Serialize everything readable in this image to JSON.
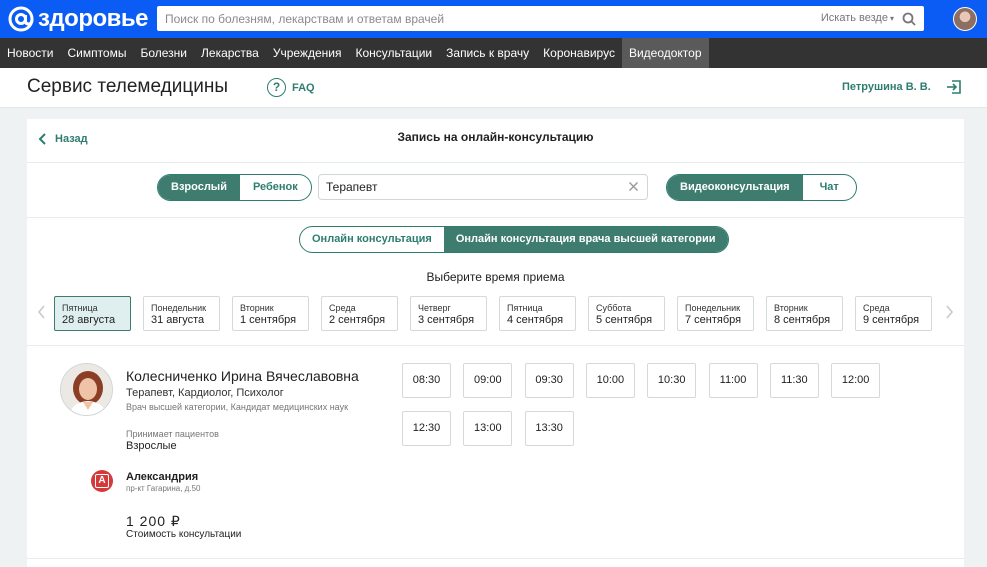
{
  "header": {
    "logo_text": "здоровье",
    "search_placeholder": "Поиск по болезням, лекарствам и ответам врачей",
    "search_scope": "Искать везде"
  },
  "nav": [
    {
      "label": "Новости",
      "active": false
    },
    {
      "label": "Симптомы",
      "active": false
    },
    {
      "label": "Болезни",
      "active": false
    },
    {
      "label": "Лекарства",
      "active": false
    },
    {
      "label": "Учреждения",
      "active": false
    },
    {
      "label": "Консультации",
      "active": false
    },
    {
      "label": "Запись к врачу",
      "active": false
    },
    {
      "label": "Коронавирус",
      "active": false
    },
    {
      "label": "Видеодоктор",
      "active": true
    }
  ],
  "page": {
    "title": "Сервис телемедицины",
    "faq": "FAQ",
    "user": "Петрушина В. В."
  },
  "booking": {
    "back": "Назад",
    "title": "Запись на онлайн-консультацию",
    "patient_types": [
      "Взрослый",
      "Ребенок"
    ],
    "specialty_value": "Терапевт",
    "consult_formats": [
      "Видеоконсультация",
      "Чат"
    ],
    "consult_types": [
      "Онлайн консультация",
      "Онлайн консультация врача высшей категории"
    ],
    "choose_time": "Выберите время приема",
    "days": [
      {
        "name": "Пятница",
        "date": "28 августа",
        "selected": true
      },
      {
        "name": "Понедельник",
        "date": "31 августа",
        "selected": false
      },
      {
        "name": "Вторник",
        "date": "1 сентября",
        "selected": false
      },
      {
        "name": "Среда",
        "date": "2 сентября",
        "selected": false
      },
      {
        "name": "Четверг",
        "date": "3 сентября",
        "selected": false
      },
      {
        "name": "Пятница",
        "date": "4 сентября",
        "selected": false
      },
      {
        "name": "Суббота",
        "date": "5 сентября",
        "selected": false
      },
      {
        "name": "Понедельник",
        "date": "7 сентября",
        "selected": false
      },
      {
        "name": "Вторник",
        "date": "8 сентября",
        "selected": false
      },
      {
        "name": "Среда",
        "date": "9 сентября",
        "selected": false
      }
    ]
  },
  "doctor": {
    "name": "Колесниченко Ирина Вячеславовна",
    "specialties": "Терапевт, Кардиолог, Психолог",
    "category": "Врач высшей категории, Кандидат медицинских наук",
    "accepts_label": "Принимает пациентов",
    "accepts_value": "Взрослые",
    "clinic_name": "Александрия",
    "clinic_address": "пр-кт Гагарина, д.50",
    "price": "1 200 ₽",
    "price_label": "Стоимость консультации",
    "slots": [
      "08:30",
      "09:00",
      "09:30",
      "10:00",
      "10:30",
      "11:00",
      "11:30",
      "12:00",
      "12:30",
      "13:00",
      "13:30"
    ]
  },
  "colors": {
    "brand_blue": "#0a5cf5",
    "accent_green": "#3d7c6e",
    "nav_dark": "#333333"
  }
}
